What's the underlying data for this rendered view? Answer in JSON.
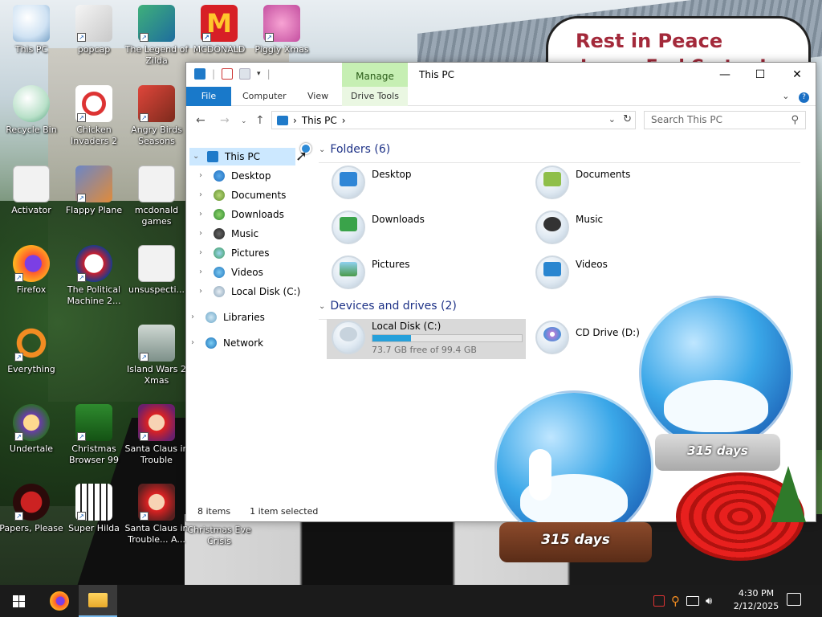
{
  "desktop": {
    "sign": {
      "line1": "Rest in Peace",
      "line2": "James Earl Carter Jr."
    },
    "icons": [
      {
        "label": "This PC"
      },
      {
        "label": "popcap"
      },
      {
        "label": "The Legend of Zilda"
      },
      {
        "label": "MCDONALD"
      },
      {
        "label": "Piggly Xmas"
      },
      {
        "label": "Recycle Bin"
      },
      {
        "label": "Chicken Invaders 2"
      },
      {
        "label": "Angry Birds Seasons"
      },
      {
        "label": "Activator"
      },
      {
        "label": "Flappy Plane"
      },
      {
        "label": "mcdonald games"
      },
      {
        "label": "Firefox"
      },
      {
        "label": "The Political Machine 2..."
      },
      {
        "label": "unsuspecti..."
      },
      {
        "label": "Everything"
      },
      {
        "label": "Island Wars 2 Xmas"
      },
      {
        "label": "Undertale"
      },
      {
        "label": "Christmas Browser 99"
      },
      {
        "label": "Santa Claus in Trouble"
      },
      {
        "label": "Papers, Please"
      },
      {
        "label": "Super Hilda"
      },
      {
        "label": "Santa Claus in Trouble... A..."
      },
      {
        "label": "Christmas Eve Crisis"
      }
    ],
    "globes": {
      "days_text": "315 days"
    }
  },
  "explorer": {
    "title": "This PC",
    "manage_tab": "Manage",
    "ribbon_tabs": {
      "file": "File",
      "computer": "Computer",
      "view": "View",
      "drive_tools": "Drive Tools"
    },
    "window_controls": {
      "minimize": "—",
      "maximize": "☐",
      "close": "✕"
    },
    "address": {
      "crumb": "This PC",
      "sep": "›"
    },
    "search": {
      "placeholder": "Search This PC"
    },
    "nav": {
      "this_pc": "This PC",
      "desktop": "Desktop",
      "documents": "Documents",
      "downloads": "Downloads",
      "music": "Music",
      "pictures": "Pictures",
      "videos": "Videos",
      "local_disk": "Local Disk (C:)",
      "libraries": "Libraries",
      "network": "Network"
    },
    "folders_group": "Folders (6)",
    "folders": {
      "desktop": "Desktop",
      "documents": "Documents",
      "downloads": "Downloads",
      "music": "Music",
      "pictures": "Pictures",
      "videos": "Videos"
    },
    "devices_group": "Devices and drives (2)",
    "drives": {
      "local": {
        "name": "Local Disk (C:)",
        "free": "73.7 GB free of 99.4 GB",
        "used_fraction": 0.26
      },
      "cd": {
        "name": "CD Drive (D:)"
      }
    },
    "status": {
      "items": "8 items",
      "selected": "1 item selected"
    }
  },
  "taskbar": {
    "time": "4:30 PM",
    "date": "2/12/2025"
  }
}
